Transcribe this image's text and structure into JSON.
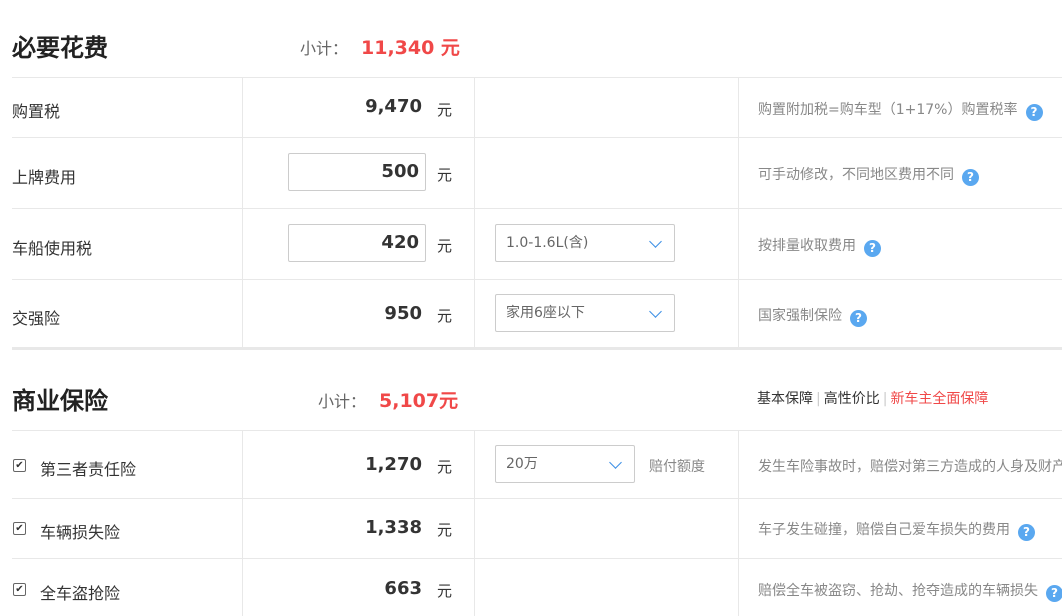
{
  "section1": {
    "title": "必要花费",
    "subtotal_label": "小计：",
    "subtotal_value": "11,340 元",
    "rows": [
      {
        "name": "购置税",
        "amount": "9,470",
        "unit": "元",
        "note": "购置附加税=购车型（1+17%）购置税率"
      },
      {
        "name": "上牌费用",
        "amount": "500",
        "unit": "元",
        "note": "可手动修改，不同地区费用不同"
      },
      {
        "name": "车船使用税",
        "amount": "420",
        "unit": "元",
        "select": "1.0-1.6L(含)",
        "note": "按排量收取费用"
      },
      {
        "name": "交强险",
        "amount": "950",
        "unit": "元",
        "select": "家用6座以下",
        "note": "国家强制保险"
      }
    ]
  },
  "section2": {
    "title": "商业保险",
    "subtotal_label": "小计：",
    "subtotal_value": "5,107元",
    "tabs": [
      "基本保障",
      "高性价比",
      "新车主全面保障"
    ],
    "rows": [
      {
        "name": "第三者责任险",
        "amount": "1,270",
        "unit": "元",
        "select": "20万",
        "select_label": "赔付额度",
        "note": "发生车险事故时，赔偿对第三方造成的人身及财产"
      },
      {
        "name": "车辆损失险",
        "amount": "1,338",
        "unit": "元",
        "note": "车子发生碰撞，赔偿自己爱车损失的费用"
      },
      {
        "name": "全车盗抢险",
        "amount": "663",
        "unit": "元",
        "note": "赔偿全车被盗窃、抢劫、抢夺造成的车辆损失"
      }
    ]
  },
  "help_icon": "?",
  "checkbox_mark": "✔",
  "colors": {
    "accent_red": "#f04848",
    "help_blue": "#5aa8f0"
  }
}
